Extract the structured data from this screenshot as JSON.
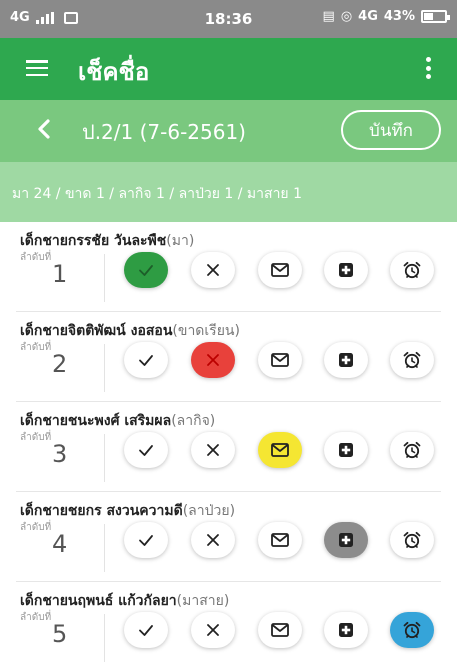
{
  "status_bar": {
    "network": "4G",
    "time": "18:36",
    "right_network": "4G",
    "battery": "43%"
  },
  "app_bar": {
    "title": "เช็คชื่อ",
    "menu_icon": "hamburger-menu-icon",
    "more_icon": "more-vertical-icon"
  },
  "sub_bar": {
    "class_info": "ป.2/1 (7-6-2561)",
    "save_label": "บันทึก",
    "back_icon": "chevron-left-icon"
  },
  "summary": "มา 24 / ขาด 1 / ลากิจ 1 / ลาป่วย 1 / มาสาย 1",
  "seq_label": "ลำดับที่",
  "icons": [
    "check-icon",
    "cross-icon",
    "envelope-icon",
    "medical-plus-icon",
    "alarm-clock-icon"
  ],
  "colors": {
    "present": "#2e9c43",
    "absent": "#e8413b",
    "leave": "#f5e632",
    "sick": "#8c8c8c",
    "late": "#35a4d9",
    "appbar": "#2ea84f"
  },
  "students": [
    {
      "name": "เด็กชายกรรชัย วันละพืช",
      "status": "(มา)",
      "seq": "1",
      "selected": 0
    },
    {
      "name": "เด็กชายจิตติพัฒน์ งอสอน",
      "status": "(ขาดเรียน)",
      "seq": "2",
      "selected": 1
    },
    {
      "name": "เด็กชายชนะพงศ์ เสริมผล",
      "status": "(ลากิจ)",
      "seq": "3",
      "selected": 2
    },
    {
      "name": "เด็กชายชยกร สงวนความดี",
      "status": "(ลาป่วย)",
      "seq": "4",
      "selected": 3
    },
    {
      "name": "เด็กชายนฤพนธ์ แก้วกัลยา",
      "status": "(มาสาย)",
      "seq": "5",
      "selected": 4
    }
  ]
}
